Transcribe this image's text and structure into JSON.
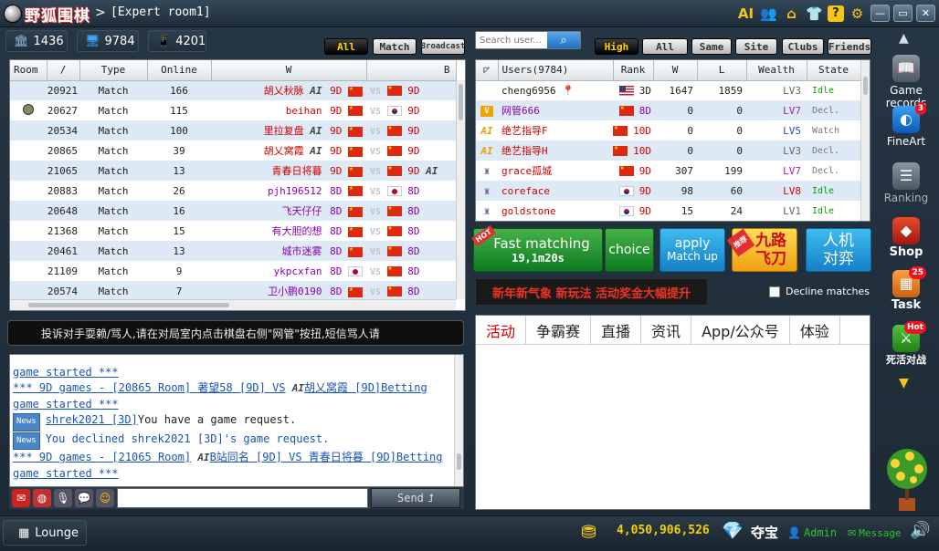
{
  "app": {
    "logo_text": "野狐围棋",
    "separator": ">",
    "window_title": "[Expert room1]",
    "ai_icon": "AI"
  },
  "stats": {
    "buildings": "1436",
    "computers": "9784",
    "mobiles": "4201"
  },
  "room_filters": {
    "all": "All",
    "match": "Match",
    "broadcast": "Broadcast"
  },
  "search": {
    "placeholder": "Search user..."
  },
  "user_filters": [
    "High",
    "All",
    "Same",
    "Site",
    "Clubs",
    "Friends"
  ],
  "rooms": {
    "headers": [
      "Room",
      "/",
      "Type",
      "Online",
      "W",
      "B"
    ],
    "rows": [
      {
        "room": "20921",
        "type": "Match",
        "online": "166",
        "w": "胡乂秋脉",
        "wai": "AI",
        "wr": "9D",
        "br": "9D",
        "bclr": "red"
      },
      {
        "room": "20627",
        "type": "Match",
        "online": "115",
        "w": "beihan",
        "wai": "",
        "wr": "9D",
        "br": "9D",
        "bclr": "red",
        "kr": true,
        "icon": true
      },
      {
        "room": "20534",
        "type": "Match",
        "online": "100",
        "w": "里拉复盘",
        "wai": "AI",
        "wr": "9D",
        "br": "9D",
        "bclr": "red"
      },
      {
        "room": "20865",
        "type": "Match",
        "online": "39",
        "w": "胡乂窝霞",
        "wai": "AI",
        "wr": "9D",
        "br": "9D",
        "bclr": "red"
      },
      {
        "room": "21065",
        "type": "Match",
        "online": "13",
        "w": "青春日将暮",
        "wai": "",
        "wr": "9D",
        "br": "9D",
        "bclr": "red",
        "bai": true
      },
      {
        "room": "20883",
        "type": "Match",
        "online": "26",
        "w": "pjh196512",
        "wai": "",
        "wr": "8D",
        "br": "8D",
        "bclr": "purple",
        "jp": true
      },
      {
        "room": "20648",
        "type": "Match",
        "online": "16",
        "w": "飞天仔仔",
        "wai": "",
        "wr": "8D",
        "br": "8D",
        "bclr": "purple"
      },
      {
        "room": "21368",
        "type": "Match",
        "online": "15",
        "w": "有大胆的想",
        "wai": "",
        "wr": "8D",
        "br": "8D",
        "bclr": "purple"
      },
      {
        "room": "20461",
        "type": "Match",
        "online": "13",
        "w": "城市迷雾",
        "wai": "",
        "wr": "8D",
        "br": "8D",
        "bclr": "purple"
      },
      {
        "room": "21109",
        "type": "Match",
        "online": "9",
        "w": "ykpcxfan",
        "wai": "",
        "wr": "8D",
        "br": "8D",
        "bclr": "purple",
        "wjp": true
      },
      {
        "room": "20574",
        "type": "Match",
        "online": "7",
        "w": "卫小鹏0190",
        "wai": "",
        "wr": "8D",
        "br": "8D",
        "bclr": "purple"
      }
    ]
  },
  "users": {
    "headers": [
      "Users(9784)",
      "Rank",
      "W",
      "L",
      "Wealth",
      "State"
    ],
    "rows": [
      {
        "name": "cheng6956",
        "flag": "us",
        "rank": "3D",
        "w": "1647",
        "l": "1859",
        "wealth": "LV3",
        "state": "Idle",
        "lvc": "",
        "stc": "green",
        "rc": "",
        "pin": true
      },
      {
        "name": "网管666",
        "flag": "cn",
        "rank": "8D",
        "w": "0",
        "l": "0",
        "wealth": "LV7",
        "state": "Decl.",
        "lvc": "pur",
        "stc": "gray",
        "rc": "purple",
        "badge": "V"
      },
      {
        "name": "绝艺指导F",
        "flag": "cn",
        "rank": "10D",
        "w": "0",
        "l": "0",
        "wealth": "LV5",
        "state": "Watch",
        "lvc": "blue",
        "stc": "gray",
        "rc": "red",
        "badge": "AI"
      },
      {
        "name": "绝艺指导H",
        "flag": "cn",
        "rank": "10D",
        "w": "0",
        "l": "0",
        "wealth": "LV3",
        "state": "Decl.",
        "lvc": "",
        "stc": "gray",
        "rc": "red",
        "badge": "AI"
      },
      {
        "name": "grace孤城",
        "flag": "cn",
        "rank": "9D",
        "w": "307",
        "l": "199",
        "wealth": "LV7",
        "state": "Decl.",
        "lvc": "pur",
        "stc": "gray",
        "rc": "red",
        "badge": "C"
      },
      {
        "name": "coreface",
        "flag": "kr",
        "rank": "9D",
        "w": "98",
        "l": "60",
        "wealth": "LV8",
        "state": "Idle",
        "lvc": "red",
        "stc": "green",
        "rc": "red",
        "badge": "C"
      },
      {
        "name": "goldstone",
        "flag": "kr",
        "rank": "9D",
        "w": "15",
        "l": "24",
        "wealth": "LV1",
        "state": "Idle",
        "lvc": "",
        "stc": "green",
        "rc": "red",
        "badge": "C"
      }
    ]
  },
  "actions": {
    "fast_label": "Fast matching",
    "fast_time": "19,1m20s",
    "hot": "HOT",
    "choice": "choice",
    "apply1": "apply",
    "apply2": "Match up",
    "jiulu1": "九路",
    "jiulu2": "飞刀",
    "jiulu_tag": "推荐",
    "renji1": "人机",
    "renji2": "对弈"
  },
  "promo": "新年新气象 新玩法 活动奖金大幅提升",
  "decline_matches": "Decline matches",
  "notice": "投诉对手耍赖/骂人,请在对局室内点击棋盘右侧\"网管\"按扭,短信骂人请",
  "news_tabs": [
    "活动",
    "争霸赛",
    "直播",
    "资讯",
    "App/公众号",
    "体验"
  ],
  "chat": {
    "line1": "*** 9D games - [20865 Room] 著望58 [9D] VS",
    "line1b": "胡乂窝霞 [9D]Betting",
    "line0": "game started ***",
    "line2": "game started ***",
    "news_label": "News",
    "n1name": "shrek2021 [3D]",
    "n1text": "You have a game request.",
    "n2text": "You declined shrek2021 [3D]'s game request.",
    "line3": "*** 9D games - [21065 Room]",
    "line3b": "B站同名 [9D] VS 青春日将暮 [9D]Betting",
    "line4": "game started ***",
    "send": "Send"
  },
  "sidebar": {
    "records": "Game records",
    "fineart": "FineArt",
    "fineart_badge": "3",
    "ranking": "Ranking",
    "shop": "Shop",
    "task": "Task",
    "task_badge": "25",
    "life": "死活对战",
    "life_badge": "Hot"
  },
  "bottom": {
    "lounge": "Lounge",
    "coins": "4,050,906,526",
    "duobao": "夺宝",
    "admin": "Admin",
    "message": "Message"
  }
}
